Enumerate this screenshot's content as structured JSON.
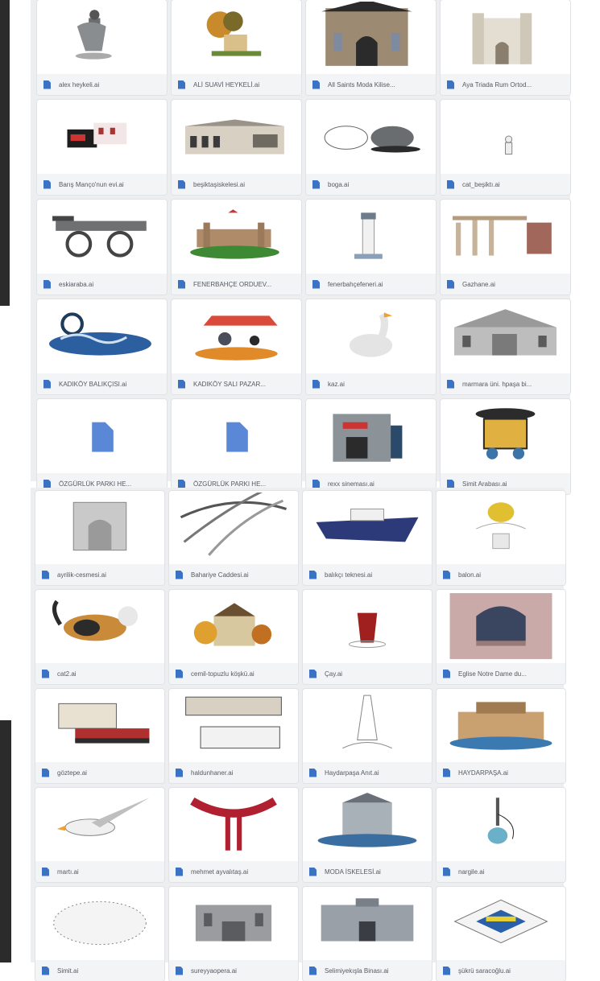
{
  "colors": {
    "panel_bg": "#eceef0",
    "file_icon": "#3b72c4",
    "label_text": "#555a60"
  },
  "top_panel": {
    "files": [
      {
        "name": "alex heykeli.ai",
        "icon": "statue"
      },
      {
        "name": "ALİ SUAVİ HEYKELİ.ai",
        "icon": "statue-tree"
      },
      {
        "name": "All Saints Moda Kilise...",
        "icon": "church"
      },
      {
        "name": "Aya Triada Rum Ortod...",
        "icon": "church-facade"
      },
      {
        "name": "Barış Manço'nun evi.ai",
        "icon": "house"
      },
      {
        "name": "beşiktaşiskelesi.ai",
        "icon": "pier-building"
      },
      {
        "name": "boga.ai",
        "icon": "bull"
      },
      {
        "name": "cat_beşiktı.ai",
        "icon": "small-cat"
      },
      {
        "name": "eskiaraba.ai",
        "icon": "cart"
      },
      {
        "name": "FENERBAHÇE ORDUEV...",
        "icon": "fortress"
      },
      {
        "name": "fenerbahçefeneri.ai",
        "icon": "lighthouse"
      },
      {
        "name": "Gazhane.ai",
        "icon": "gasworks"
      },
      {
        "name": "KADIKÖY BALIKÇISI.ai",
        "icon": "fishing"
      },
      {
        "name": "KADIKÖY SALI PAZAR...",
        "icon": "market"
      },
      {
        "name": "kaz.ai",
        "icon": "goose"
      },
      {
        "name": "marmara üni. hpaşa bi...",
        "icon": "university"
      },
      {
        "name": "ÖZGÜRLÜK PARKI HE...",
        "icon": "blank-doc"
      },
      {
        "name": "ÖZGÜRLÜK PARKI HE...",
        "icon": "blank-doc"
      },
      {
        "name": "rexx sineması.ai",
        "icon": "cinema"
      },
      {
        "name": "Simit Arabası.ai",
        "icon": "simit-cart"
      }
    ]
  },
  "bottom_panel": {
    "files": [
      {
        "name": "ayrilik-cesmesi.ai",
        "icon": "fountain"
      },
      {
        "name": "Bahariye Caddesi.ai",
        "icon": "street"
      },
      {
        "name": "balıkçı teknesi.ai",
        "icon": "boat"
      },
      {
        "name": "balon.ai",
        "icon": "balloon"
      },
      {
        "name": "cat2.ai",
        "icon": "cat"
      },
      {
        "name": "cemil-topuzlu köşkü.ai",
        "icon": "mansion"
      },
      {
        "name": "Çay.ai",
        "icon": "tea"
      },
      {
        "name": "Eglise Notre Dame du...",
        "icon": "arched-window"
      },
      {
        "name": "göztepe.ai",
        "icon": "train-station"
      },
      {
        "name": "haldunhaner.ai",
        "icon": "buildings"
      },
      {
        "name": "Haydarpaşa Anıt.ai",
        "icon": "monument"
      },
      {
        "name": "HAYDARPAŞA.ai",
        "icon": "station"
      },
      {
        "name": "martı.ai",
        "icon": "seagull"
      },
      {
        "name": "mehmet ayvalıtaş.ai",
        "icon": "sculpture"
      },
      {
        "name": "MODA İSKELESİ.ai",
        "icon": "pier"
      },
      {
        "name": "nargile.ai",
        "icon": "hookah"
      },
      {
        "name": "Simit.ai",
        "icon": "simit"
      },
      {
        "name": "sureyyaopera.ai",
        "icon": "opera"
      },
      {
        "name": "Selimiyekışla Binası.ai",
        "icon": "barracks"
      },
      {
        "name": "şükrü saracoğlu.ai",
        "icon": "stadium"
      }
    ]
  }
}
